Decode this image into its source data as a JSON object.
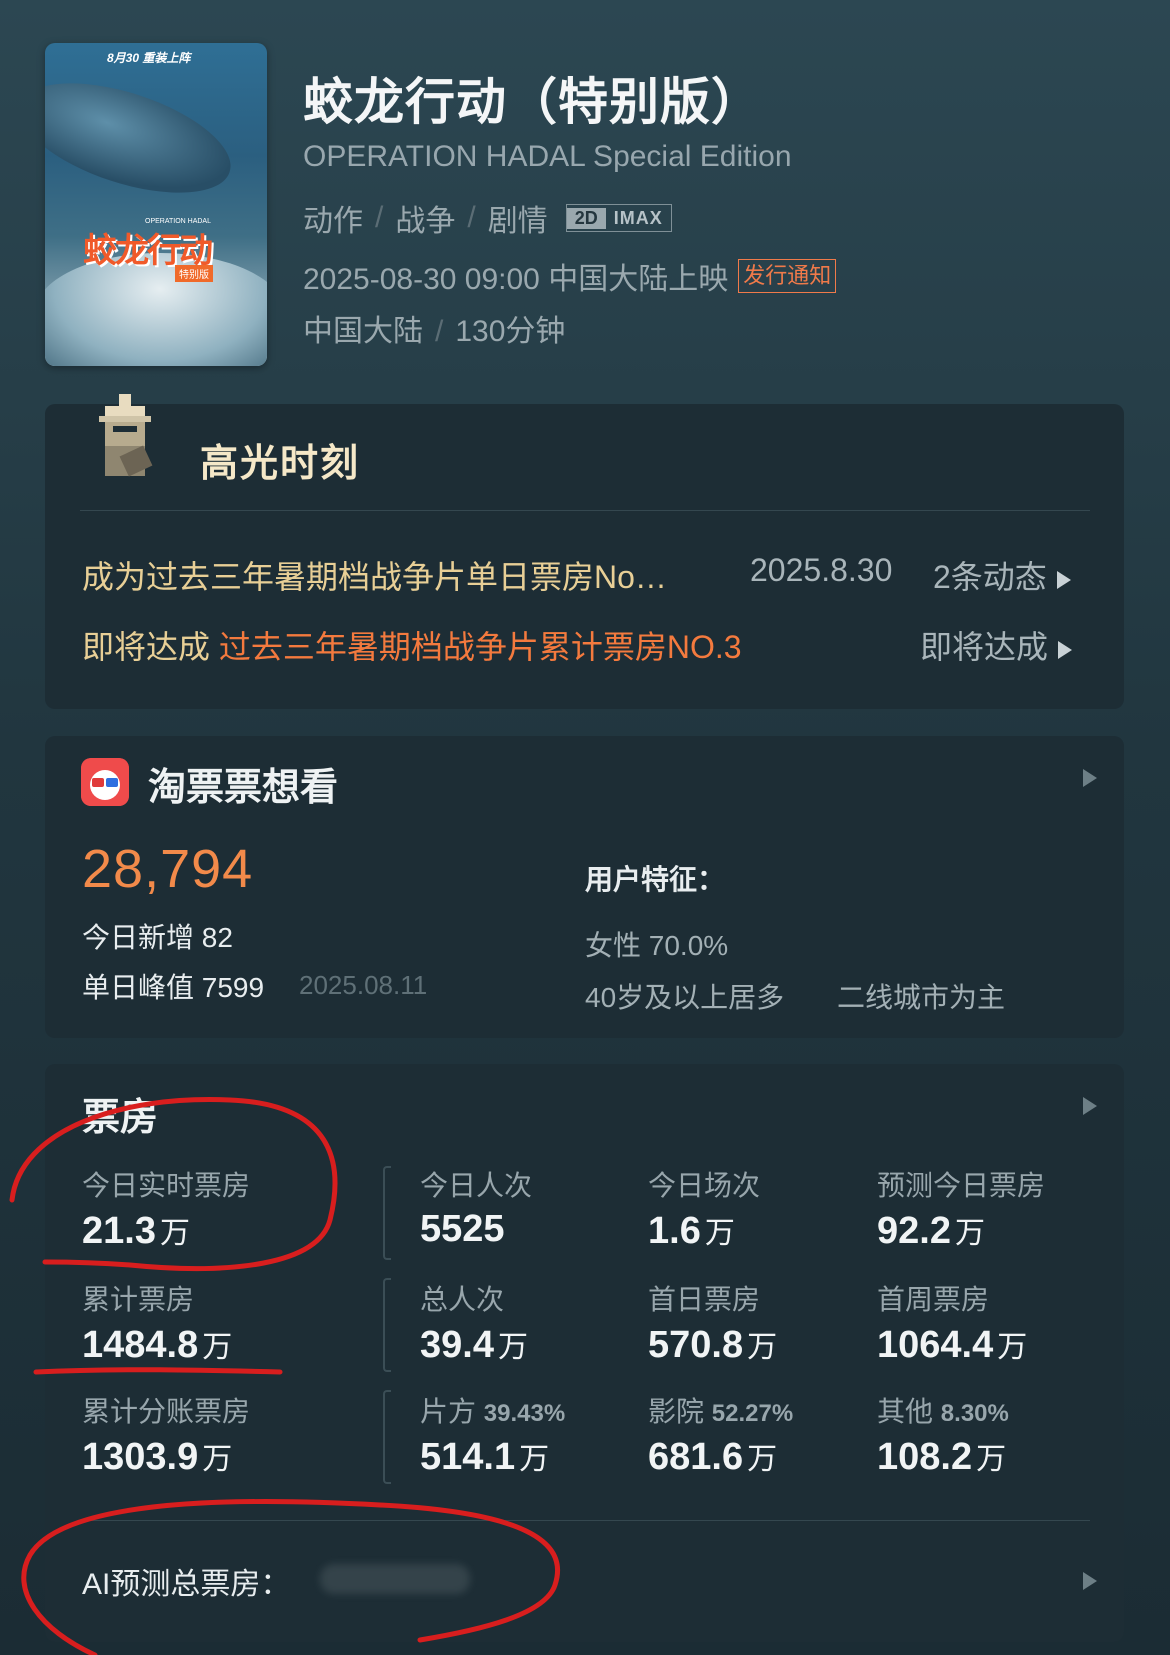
{
  "poster": {
    "badge_date": "8月30",
    "badge_text": "重装上阵",
    "title_art": "蛟龙行动",
    "tag": "特别版",
    "small_en": "OPERATION HADAL"
  },
  "movie": {
    "title": "蛟龙行动（特别版）",
    "title_en": "OPERATION HADAL Special Edition",
    "genres": [
      "动作",
      "战争",
      "剧情"
    ],
    "formats": [
      "2D",
      "IMAX"
    ],
    "release": "2025-08-30 09:00 中国大陆上映",
    "notice": "发行通知",
    "region": "中国大陆",
    "duration": "130分钟"
  },
  "highlights": {
    "title": "高光时刻",
    "item1": "成为过去三年暑期档战争片单日票房No…",
    "item1_date": "2025.8.30",
    "item1_dyn": "2条动态",
    "item2_prefix": "即将达成",
    "item2_hot": "过去三年暑期档战争片累计票房NO.3",
    "item2_action": "即将达成"
  },
  "taopiao": {
    "title": "淘票票想看",
    "want_count": "28,794",
    "today_new": "今日新增 82",
    "peak": "单日峰值 7599",
    "peak_date": "2025.08.11",
    "user_title": "用户特征：",
    "female": "女性 70.0%",
    "age": "40岁及以上居多",
    "city": "二线城市为主"
  },
  "boxoffice": {
    "title": "票房",
    "unit": "万",
    "cells": [
      {
        "label": "今日实时票房",
        "value": "21.3",
        "unit": "万"
      },
      {
        "label": "今日人次",
        "value": "5525",
        "unit": ""
      },
      {
        "label": "今日场次",
        "value": "1.6",
        "unit": "万"
      },
      {
        "label": "预测今日票房",
        "value": "92.2",
        "unit": "万"
      },
      {
        "label": "累计票房",
        "value": "1484.8",
        "unit": "万"
      },
      {
        "label": "总人次",
        "value": "39.4",
        "unit": "万"
      },
      {
        "label": "首日票房",
        "value": "570.8",
        "unit": "万"
      },
      {
        "label": "首周票房",
        "value": "1064.4",
        "unit": "万"
      },
      {
        "label": "累计分账票房",
        "value": "1303.9",
        "unit": "万"
      },
      {
        "label": "片方",
        "pct": "39.43%",
        "value": "514.1",
        "unit": "万"
      },
      {
        "label": "影院",
        "pct": "52.27%",
        "value": "681.6",
        "unit": "万"
      },
      {
        "label": "其他",
        "pct": "8.30%",
        "value": "108.2",
        "unit": "万"
      }
    ],
    "ai_label": "AI预测总票房："
  },
  "colors": {
    "accent_orange": "#f28a4a",
    "annotation_red": "#d81e1e",
    "gold": "#e8cf96"
  }
}
